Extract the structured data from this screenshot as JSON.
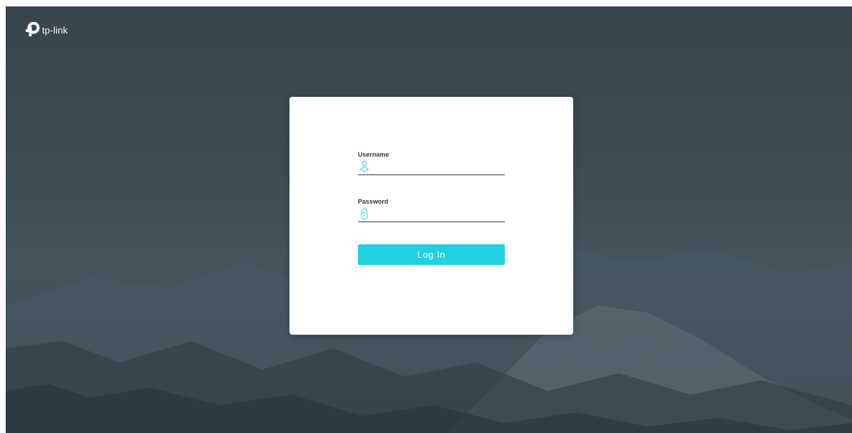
{
  "brand": {
    "name": "tp-link",
    "logo_icon": "tp-link-logo-icon"
  },
  "login": {
    "username_label": "Username",
    "username_value": "",
    "username_icon": "user-icon",
    "password_label": "Password",
    "password_value": "",
    "password_icon": "lock-icon",
    "submit_label": "Log In"
  },
  "colors": {
    "accent": "#23d0e2",
    "background": "#3b4b54",
    "card": "#ffffff",
    "icon": "#4fc4d6"
  }
}
